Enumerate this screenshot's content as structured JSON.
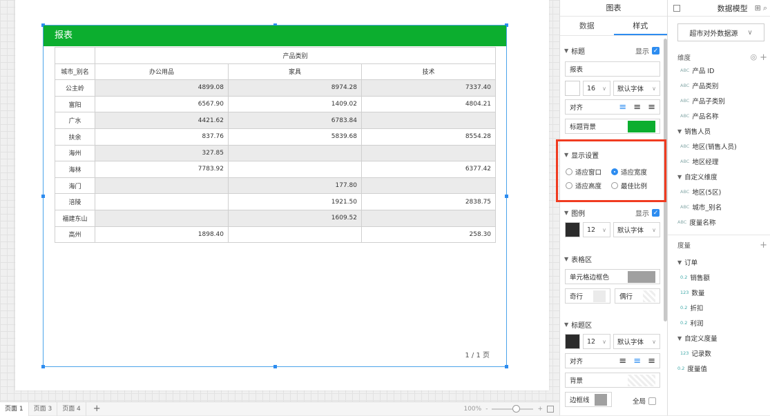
{
  "report": {
    "title": "报表",
    "group_header": "产品类别",
    "row_header": "城市_别名",
    "columns": [
      "办公用品",
      "家具",
      "技术"
    ],
    "rows": [
      {
        "city": "公主岭",
        "values": [
          "4899.08",
          "8974.28",
          "7337.40"
        ]
      },
      {
        "city": "富阳",
        "values": [
          "6567.90",
          "1409.02",
          "4804.21"
        ]
      },
      {
        "city": "广水",
        "values": [
          "4421.62",
          "6783.84",
          ""
        ]
      },
      {
        "city": "扶余",
        "values": [
          "837.76",
          "5839.68",
          "8554.28"
        ]
      },
      {
        "city": "海州",
        "values": [
          "327.85",
          "",
          ""
        ]
      },
      {
        "city": "海林",
        "values": [
          "7783.92",
          "",
          "6377.42"
        ]
      },
      {
        "city": "海门",
        "values": [
          "",
          "177.80",
          ""
        ]
      },
      {
        "city": "涪陵",
        "values": [
          "",
          "1921.50",
          "2838.75"
        ]
      },
      {
        "city": "福建东山",
        "values": [
          "",
          "1609.52",
          ""
        ]
      },
      {
        "city": "高州",
        "values": [
          "1898.40",
          "",
          "258.30"
        ]
      }
    ],
    "pager": "1 / 1 页"
  },
  "pages": [
    "页面 1",
    "页面 3",
    "页面 4"
  ],
  "add_page": "+",
  "zoom": "100%",
  "zoom_minus": "-",
  "zoom_plus": "+",
  "middle": {
    "title": "图表",
    "tabs": [
      "数据",
      "样式"
    ],
    "title_section": {
      "label": "标题",
      "show": "显示",
      "text": "报表",
      "font_size": "16",
      "font_family": "默认字体",
      "align": "对齐",
      "bg_label": "标题背景",
      "bg_color": "#0cae2f"
    },
    "display": {
      "label": "显示设置",
      "options": [
        "适应窗口",
        "适应宽度",
        "适应高度",
        "最佳比例"
      ],
      "selected": "适应宽度"
    },
    "legend": {
      "label": "图例",
      "show": "显示",
      "font_size": "12",
      "font_family": "默认字体"
    },
    "table_area": {
      "label": "表格区",
      "border_color": "单元格边框色",
      "odd": "奇行",
      "even": "偶行"
    },
    "title_area": {
      "label": "标题区",
      "font_size": "12",
      "font_family": "默认字体",
      "align": "对齐",
      "bg": "背景",
      "border": "边框线",
      "global": "全局"
    }
  },
  "right": {
    "title": "数据模型",
    "source": "超市对外数据源",
    "dimensions_label": "维度",
    "dimensions": [
      {
        "type": "ABC",
        "name": "产品 ID",
        "indent": 1
      },
      {
        "type": "ABC",
        "name": "产品类别",
        "indent": 1
      },
      {
        "type": "ABC",
        "name": "产品子类别",
        "indent": 1
      },
      {
        "type": "ABC",
        "name": "产品名称",
        "indent": 1
      },
      {
        "type": "",
        "name": "销售人员",
        "group": true
      },
      {
        "type": "ABC",
        "name": "地区(销售人员)",
        "indent": 1
      },
      {
        "type": "ABC",
        "name": "地区经理",
        "indent": 1
      },
      {
        "type": "",
        "name": "自定义维度",
        "group": true
      },
      {
        "type": "ABC",
        "name": "地区(5区)",
        "indent": 1
      },
      {
        "type": "ABC",
        "name": "城市_别名",
        "indent": 1
      },
      {
        "type": "ABC",
        "name": "度量名称",
        "indent": 0
      }
    ],
    "measures_label": "度量",
    "measures": [
      {
        "type": "",
        "name": "订单",
        "group": true
      },
      {
        "type": "0.2",
        "name": "销售额",
        "indent": 1
      },
      {
        "type": "123",
        "name": "数量",
        "indent": 1
      },
      {
        "type": "0.2",
        "name": "折扣",
        "indent": 1
      },
      {
        "type": "0.2",
        "name": "利润",
        "indent": 1
      },
      {
        "type": "",
        "name": "自定义度量",
        "group": true
      },
      {
        "type": "123",
        "name": "记录数",
        "indent": 1
      },
      {
        "type": "0.2",
        "name": "度量值",
        "indent": 0
      }
    ]
  }
}
